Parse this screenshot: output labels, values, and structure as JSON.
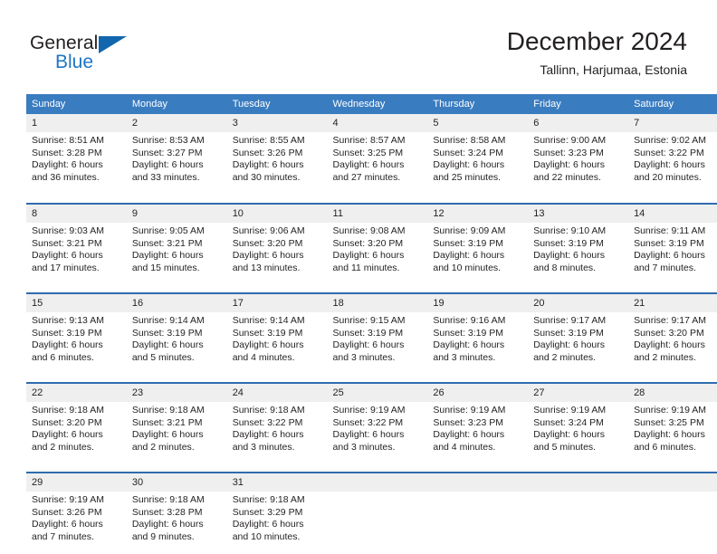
{
  "brand": {
    "name_primary": "General",
    "name_secondary": "Blue",
    "flag_icon": "brand-flag-icon",
    "accent_color": "#1266ad"
  },
  "header": {
    "title": "December 2024",
    "subtitle": "Tallinn, Harjumaa, Estonia"
  },
  "calendar": {
    "header_color": "#3a7cc0",
    "row_border_color": "#2f6cae",
    "daynum_band_color": "#efefef",
    "weekday_headers": [
      "Sunday",
      "Monday",
      "Tuesday",
      "Wednesday",
      "Thursday",
      "Friday",
      "Saturday"
    ],
    "weeks": [
      [
        {
          "day": "1",
          "sunrise": "Sunrise: 8:51 AM",
          "sunset": "Sunset: 3:28 PM",
          "daylight1": "Daylight: 6 hours",
          "daylight2": "and 36 minutes."
        },
        {
          "day": "2",
          "sunrise": "Sunrise: 8:53 AM",
          "sunset": "Sunset: 3:27 PM",
          "daylight1": "Daylight: 6 hours",
          "daylight2": "and 33 minutes."
        },
        {
          "day": "3",
          "sunrise": "Sunrise: 8:55 AM",
          "sunset": "Sunset: 3:26 PM",
          "daylight1": "Daylight: 6 hours",
          "daylight2": "and 30 minutes."
        },
        {
          "day": "4",
          "sunrise": "Sunrise: 8:57 AM",
          "sunset": "Sunset: 3:25 PM",
          "daylight1": "Daylight: 6 hours",
          "daylight2": "and 27 minutes."
        },
        {
          "day": "5",
          "sunrise": "Sunrise: 8:58 AM",
          "sunset": "Sunset: 3:24 PM",
          "daylight1": "Daylight: 6 hours",
          "daylight2": "and 25 minutes."
        },
        {
          "day": "6",
          "sunrise": "Sunrise: 9:00 AM",
          "sunset": "Sunset: 3:23 PM",
          "daylight1": "Daylight: 6 hours",
          "daylight2": "and 22 minutes."
        },
        {
          "day": "7",
          "sunrise": "Sunrise: 9:02 AM",
          "sunset": "Sunset: 3:22 PM",
          "daylight1": "Daylight: 6 hours",
          "daylight2": "and 20 minutes."
        }
      ],
      [
        {
          "day": "8",
          "sunrise": "Sunrise: 9:03 AM",
          "sunset": "Sunset: 3:21 PM",
          "daylight1": "Daylight: 6 hours",
          "daylight2": "and 17 minutes."
        },
        {
          "day": "9",
          "sunrise": "Sunrise: 9:05 AM",
          "sunset": "Sunset: 3:21 PM",
          "daylight1": "Daylight: 6 hours",
          "daylight2": "and 15 minutes."
        },
        {
          "day": "10",
          "sunrise": "Sunrise: 9:06 AM",
          "sunset": "Sunset: 3:20 PM",
          "daylight1": "Daylight: 6 hours",
          "daylight2": "and 13 minutes."
        },
        {
          "day": "11",
          "sunrise": "Sunrise: 9:08 AM",
          "sunset": "Sunset: 3:20 PM",
          "daylight1": "Daylight: 6 hours",
          "daylight2": "and 11 minutes."
        },
        {
          "day": "12",
          "sunrise": "Sunrise: 9:09 AM",
          "sunset": "Sunset: 3:19 PM",
          "daylight1": "Daylight: 6 hours",
          "daylight2": "and 10 minutes."
        },
        {
          "day": "13",
          "sunrise": "Sunrise: 9:10 AM",
          "sunset": "Sunset: 3:19 PM",
          "daylight1": "Daylight: 6 hours",
          "daylight2": "and 8 minutes."
        },
        {
          "day": "14",
          "sunrise": "Sunrise: 9:11 AM",
          "sunset": "Sunset: 3:19 PM",
          "daylight1": "Daylight: 6 hours",
          "daylight2": "and 7 minutes."
        }
      ],
      [
        {
          "day": "15",
          "sunrise": "Sunrise: 9:13 AM",
          "sunset": "Sunset: 3:19 PM",
          "daylight1": "Daylight: 6 hours",
          "daylight2": "and 6 minutes."
        },
        {
          "day": "16",
          "sunrise": "Sunrise: 9:14 AM",
          "sunset": "Sunset: 3:19 PM",
          "daylight1": "Daylight: 6 hours",
          "daylight2": "and 5 minutes."
        },
        {
          "day": "17",
          "sunrise": "Sunrise: 9:14 AM",
          "sunset": "Sunset: 3:19 PM",
          "daylight1": "Daylight: 6 hours",
          "daylight2": "and 4 minutes."
        },
        {
          "day": "18",
          "sunrise": "Sunrise: 9:15 AM",
          "sunset": "Sunset: 3:19 PM",
          "daylight1": "Daylight: 6 hours",
          "daylight2": "and 3 minutes."
        },
        {
          "day": "19",
          "sunrise": "Sunrise: 9:16 AM",
          "sunset": "Sunset: 3:19 PM",
          "daylight1": "Daylight: 6 hours",
          "daylight2": "and 3 minutes."
        },
        {
          "day": "20",
          "sunrise": "Sunrise: 9:17 AM",
          "sunset": "Sunset: 3:19 PM",
          "daylight1": "Daylight: 6 hours",
          "daylight2": "and 2 minutes."
        },
        {
          "day": "21",
          "sunrise": "Sunrise: 9:17 AM",
          "sunset": "Sunset: 3:20 PM",
          "daylight1": "Daylight: 6 hours",
          "daylight2": "and 2 minutes."
        }
      ],
      [
        {
          "day": "22",
          "sunrise": "Sunrise: 9:18 AM",
          "sunset": "Sunset: 3:20 PM",
          "daylight1": "Daylight: 6 hours",
          "daylight2": "and 2 minutes."
        },
        {
          "day": "23",
          "sunrise": "Sunrise: 9:18 AM",
          "sunset": "Sunset: 3:21 PM",
          "daylight1": "Daylight: 6 hours",
          "daylight2": "and 2 minutes."
        },
        {
          "day": "24",
          "sunrise": "Sunrise: 9:18 AM",
          "sunset": "Sunset: 3:22 PM",
          "daylight1": "Daylight: 6 hours",
          "daylight2": "and 3 minutes."
        },
        {
          "day": "25",
          "sunrise": "Sunrise: 9:19 AM",
          "sunset": "Sunset: 3:22 PM",
          "daylight1": "Daylight: 6 hours",
          "daylight2": "and 3 minutes."
        },
        {
          "day": "26",
          "sunrise": "Sunrise: 9:19 AM",
          "sunset": "Sunset: 3:23 PM",
          "daylight1": "Daylight: 6 hours",
          "daylight2": "and 4 minutes."
        },
        {
          "day": "27",
          "sunrise": "Sunrise: 9:19 AM",
          "sunset": "Sunset: 3:24 PM",
          "daylight1": "Daylight: 6 hours",
          "daylight2": "and 5 minutes."
        },
        {
          "day": "28",
          "sunrise": "Sunrise: 9:19 AM",
          "sunset": "Sunset: 3:25 PM",
          "daylight1": "Daylight: 6 hours",
          "daylight2": "and 6 minutes."
        }
      ],
      [
        {
          "day": "29",
          "sunrise": "Sunrise: 9:19 AM",
          "sunset": "Sunset: 3:26 PM",
          "daylight1": "Daylight: 6 hours",
          "daylight2": "and 7 minutes."
        },
        {
          "day": "30",
          "sunrise": "Sunrise: 9:18 AM",
          "sunset": "Sunset: 3:28 PM",
          "daylight1": "Daylight: 6 hours",
          "daylight2": "and 9 minutes."
        },
        {
          "day": "31",
          "sunrise": "Sunrise: 9:18 AM",
          "sunset": "Sunset: 3:29 PM",
          "daylight1": "Daylight: 6 hours",
          "daylight2": "and 10 minutes."
        },
        {
          "day": "",
          "sunrise": "",
          "sunset": "",
          "daylight1": "",
          "daylight2": ""
        },
        {
          "day": "",
          "sunrise": "",
          "sunset": "",
          "daylight1": "",
          "daylight2": ""
        },
        {
          "day": "",
          "sunrise": "",
          "sunset": "",
          "daylight1": "",
          "daylight2": ""
        },
        {
          "day": "",
          "sunrise": "",
          "sunset": "",
          "daylight1": "",
          "daylight2": ""
        }
      ]
    ]
  }
}
